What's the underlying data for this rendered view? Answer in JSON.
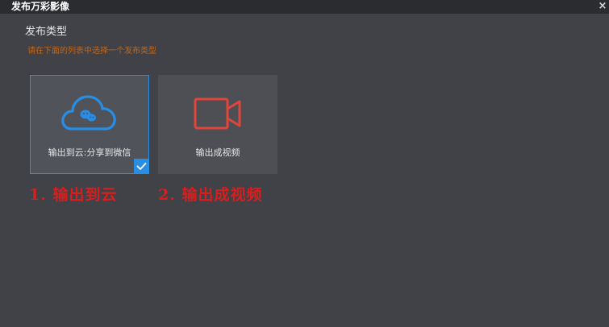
{
  "window": {
    "title": "发布万彩影像",
    "close_label": "×"
  },
  "publish": {
    "section_title": "发布类型",
    "hint": "请在下面的列表中选择一个发布类型",
    "options": [
      {
        "label": "输出到云:分享到微信",
        "icon": "cloud-wechat-icon",
        "selected": true
      },
      {
        "label": "输出成视频",
        "icon": "video-camera-icon",
        "selected": false
      }
    ]
  },
  "annotations": [
    "1. 输出到云",
    "2. 输出成视频"
  ],
  "colors": {
    "accent": "#2a8de4",
    "video_icon": "#e0463a",
    "hint": "#c0661a",
    "annotation": "#d81e1e",
    "background": "#404247"
  }
}
